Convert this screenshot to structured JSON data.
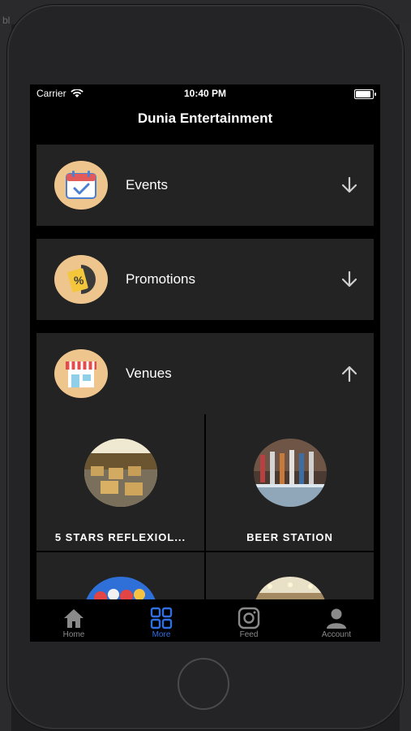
{
  "background": {
    "tab_text": "bl"
  },
  "status_bar": {
    "carrier": "Carrier",
    "time": "10:40 PM"
  },
  "nav": {
    "title": "Dunia Entertainment"
  },
  "sections": [
    {
      "label": "Events",
      "icon": "calendar-check-icon",
      "expanded": false
    },
    {
      "label": "Promotions",
      "icon": "percent-tag-icon",
      "expanded": false
    },
    {
      "label": "Venues",
      "icon": "store-icon",
      "expanded": true
    }
  ],
  "venues": [
    {
      "name": "5 STARS REFLEXIOL...",
      "image": "spa-room-photo"
    },
    {
      "name": "BEER STATION",
      "image": "beer-taps-photo"
    },
    {
      "name": "",
      "image": "balloons-photo"
    },
    {
      "name": "",
      "image": "venue-interior-photo"
    }
  ],
  "tab_bar": {
    "items": [
      {
        "label": "Home",
        "icon": "home-icon",
        "active": false
      },
      {
        "label": "More",
        "icon": "grid-icon",
        "active": true
      },
      {
        "label": "Feed",
        "icon": "instagram-icon",
        "active": false
      },
      {
        "label": "Account",
        "icon": "person-icon",
        "active": false
      }
    ]
  },
  "colors": {
    "accent": "#2f6fe0",
    "icon_bg": "#efc58e",
    "row_bg": "#232323"
  }
}
